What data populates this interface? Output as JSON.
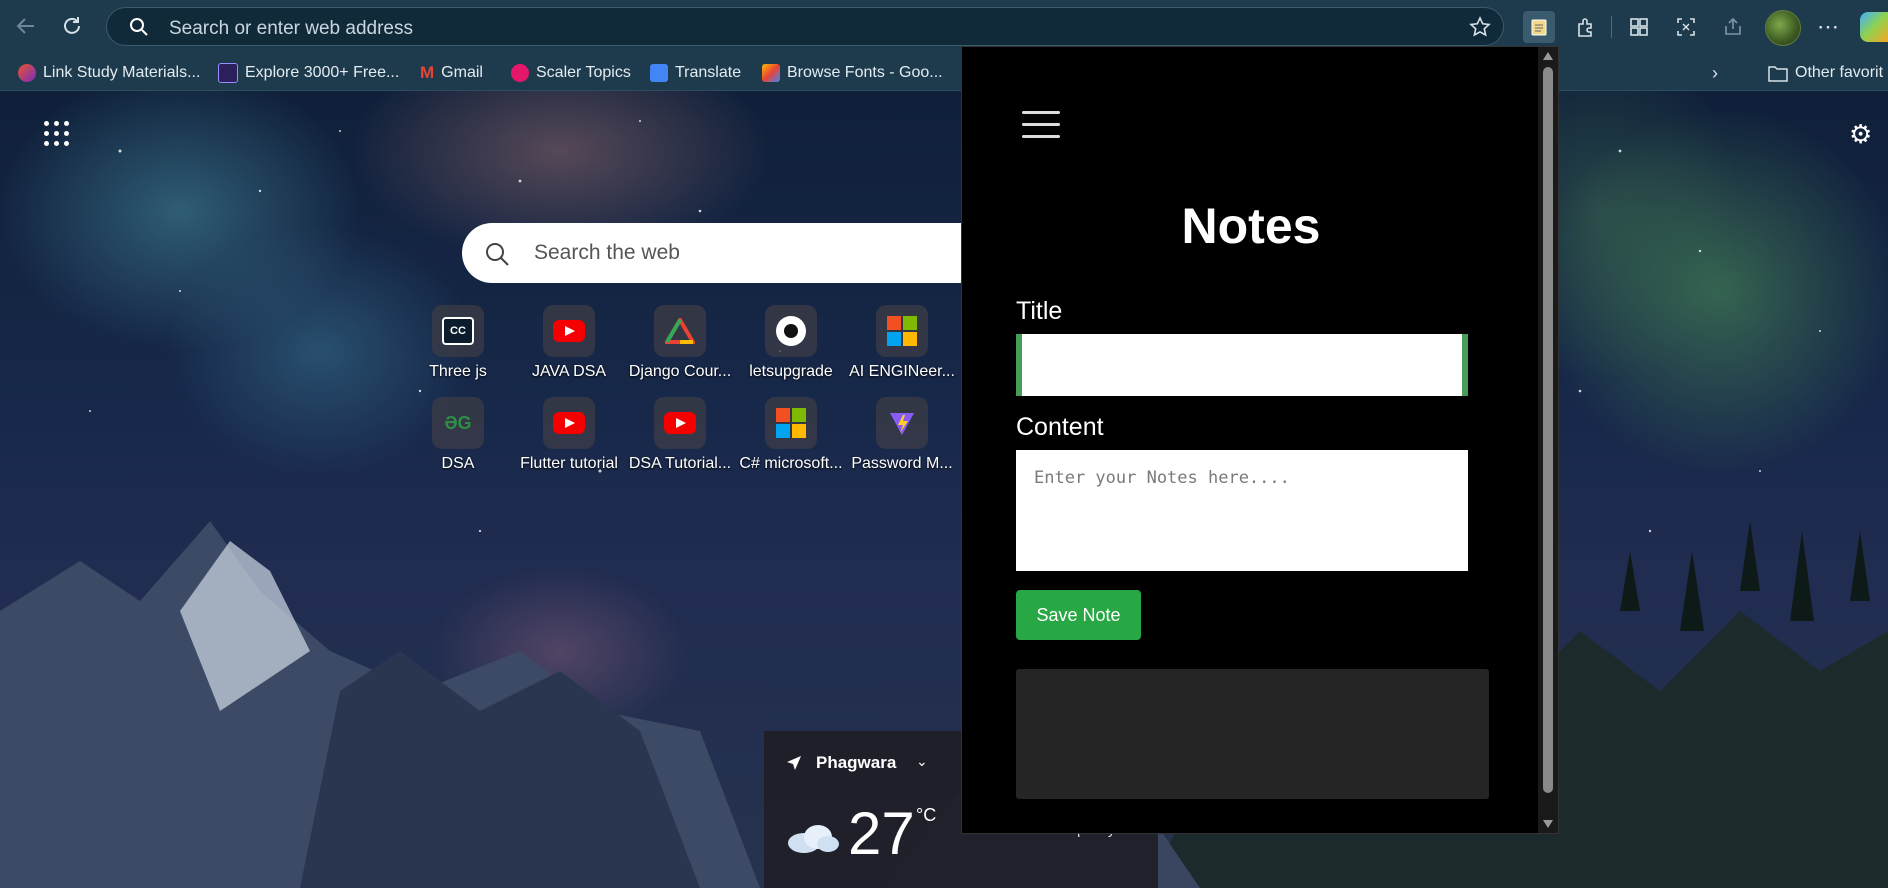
{
  "browser": {
    "address_placeholder": "Search or enter web address",
    "bookmarks": [
      {
        "label": "Link Study Materials...",
        "color": "#e8542c"
      },
      {
        "label": "Explore 3000+ Free...",
        "color": "#2b1f5c"
      },
      {
        "label": "Gmail",
        "color": "#ea4335"
      },
      {
        "label": "Scaler Topics",
        "color": "#e5176b"
      },
      {
        "label": "Translate",
        "color": "#4285f4"
      },
      {
        "label": "Browse Fonts - Goo...",
        "color": "#fbbc04"
      }
    ],
    "other_favorites": "Other favorit"
  },
  "newtab": {
    "search_placeholder": "Search the web",
    "tiles": [
      {
        "label": "Three js",
        "icon": "cc-icon"
      },
      {
        "label": "JAVA DSA",
        "icon": "youtube-icon"
      },
      {
        "label": "Django Cour...",
        "icon": "triangle-logo-icon"
      },
      {
        "label": "letsupgrade",
        "icon": "letsupgrade-icon"
      },
      {
        "label": "AI ENGINeer...",
        "icon": "microsoft-icon"
      },
      {
        "label": "DSA",
        "icon": "gfg-icon"
      },
      {
        "label": "Flutter tutorial",
        "icon": "youtube-icon"
      },
      {
        "label": "DSA Tutorial...",
        "icon": "youtube-icon"
      },
      {
        "label": "C# microsoft...",
        "icon": "microsoft-icon"
      },
      {
        "label": "Password M...",
        "icon": "vite-icon"
      }
    ],
    "weather": {
      "location": "Phagwara",
      "temperature": "27",
      "unit": "°C",
      "extra": "quality"
    }
  },
  "popup": {
    "title": "Notes",
    "title_label": "Title",
    "title_value": "",
    "content_label": "Content",
    "content_placeholder": "Enter your Notes here....",
    "save_label": "Save Note"
  }
}
